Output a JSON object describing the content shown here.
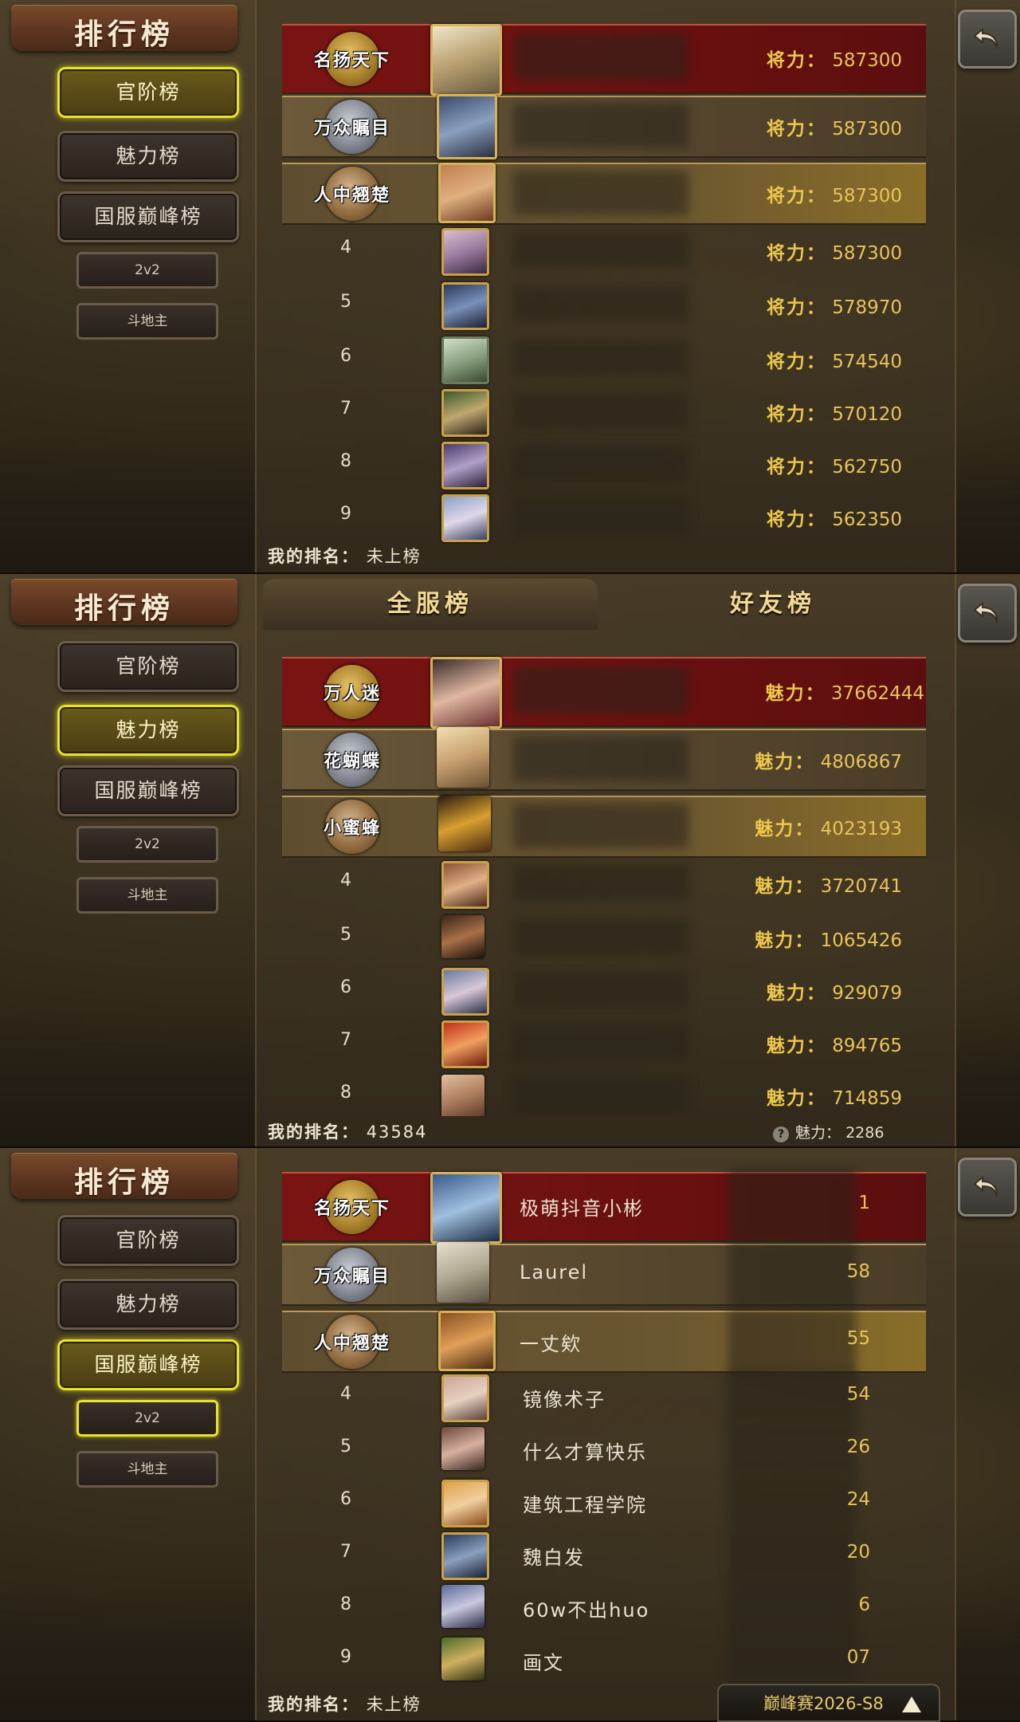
{
  "screen_title": "排行榜",
  "nav": {
    "main": [
      "官阶榜",
      "魅力榜",
      "国服巅峰榜"
    ],
    "sub": [
      "2v2",
      "斗地主"
    ]
  },
  "panels": [
    {
      "active_nav": "官阶榜",
      "score_label": "将力：",
      "medal_titles": [
        "名扬天下",
        "万众瞩目",
        "人中翘楚"
      ],
      "rows": [
        {
          "rank": "1",
          "score": "587300"
        },
        {
          "rank": "2",
          "score": "587300"
        },
        {
          "rank": "3",
          "score": "587300"
        },
        {
          "rank": "4",
          "score": "587300"
        },
        {
          "rank": "5",
          "score": "578970"
        },
        {
          "rank": "6",
          "score": "574540"
        },
        {
          "rank": "7",
          "score": "570120"
        },
        {
          "rank": "8",
          "score": "562750"
        },
        {
          "rank": "9",
          "score": "562350"
        }
      ],
      "my_rank_label": "我的排名：",
      "my_rank_value": "未上榜"
    },
    {
      "active_nav": "魅力榜",
      "tabs": [
        "全服榜",
        "好友榜"
      ],
      "score_label": "魅力：",
      "medal_titles": [
        "万人迷",
        "花蝴蝶",
        "小蜜蜂"
      ],
      "rows": [
        {
          "rank": "1",
          "score": "37662444"
        },
        {
          "rank": "2",
          "score": "4806867"
        },
        {
          "rank": "3",
          "score": "4023193"
        },
        {
          "rank": "4",
          "score": "3720741"
        },
        {
          "rank": "5",
          "score": "1065426"
        },
        {
          "rank": "6",
          "score": "929079"
        },
        {
          "rank": "7",
          "score": "894765"
        },
        {
          "rank": "8",
          "score": "714859"
        }
      ],
      "my_rank_label": "我的排名：",
      "my_rank_value": "43584",
      "my_score_label": "魅力：",
      "my_score_value": "2286"
    },
    {
      "active_nav": "国服巅峰榜",
      "medal_titles": [
        "名扬天下",
        "万众瞩目",
        "人中翘楚"
      ],
      "rows": [
        {
          "rank": "1",
          "name": "极萌抖音小彬"
        },
        {
          "rank": "2",
          "name": "Laurel"
        },
        {
          "rank": "3",
          "name": "一丈欸"
        },
        {
          "rank": "4",
          "name": "镜像术子"
        },
        {
          "rank": "5",
          "name": "什么才算快乐"
        },
        {
          "rank": "6",
          "name": "建筑工程学院"
        },
        {
          "rank": "7",
          "name": "魏白发"
        },
        {
          "rank": "8",
          "name": "60w不出huo"
        },
        {
          "rank": "9",
          "name": "画文"
        }
      ],
      "partial_scores": [
        "1",
        "58",
        "55",
        "54",
        "26",
        "24",
        "20",
        "6",
        "07"
      ],
      "my_rank_label": "我的排名：",
      "my_rank_value": "未上榜",
      "season_label": "巅峰赛2026-S8"
    }
  ],
  "colors": {
    "active_border": "#e7e22a",
    "score_gold": "#e7c35a",
    "first_row_red": "#7a1412"
  },
  "icons": [
    "back-arrow-icon",
    "question-icon",
    "triangle-up-icon"
  ]
}
